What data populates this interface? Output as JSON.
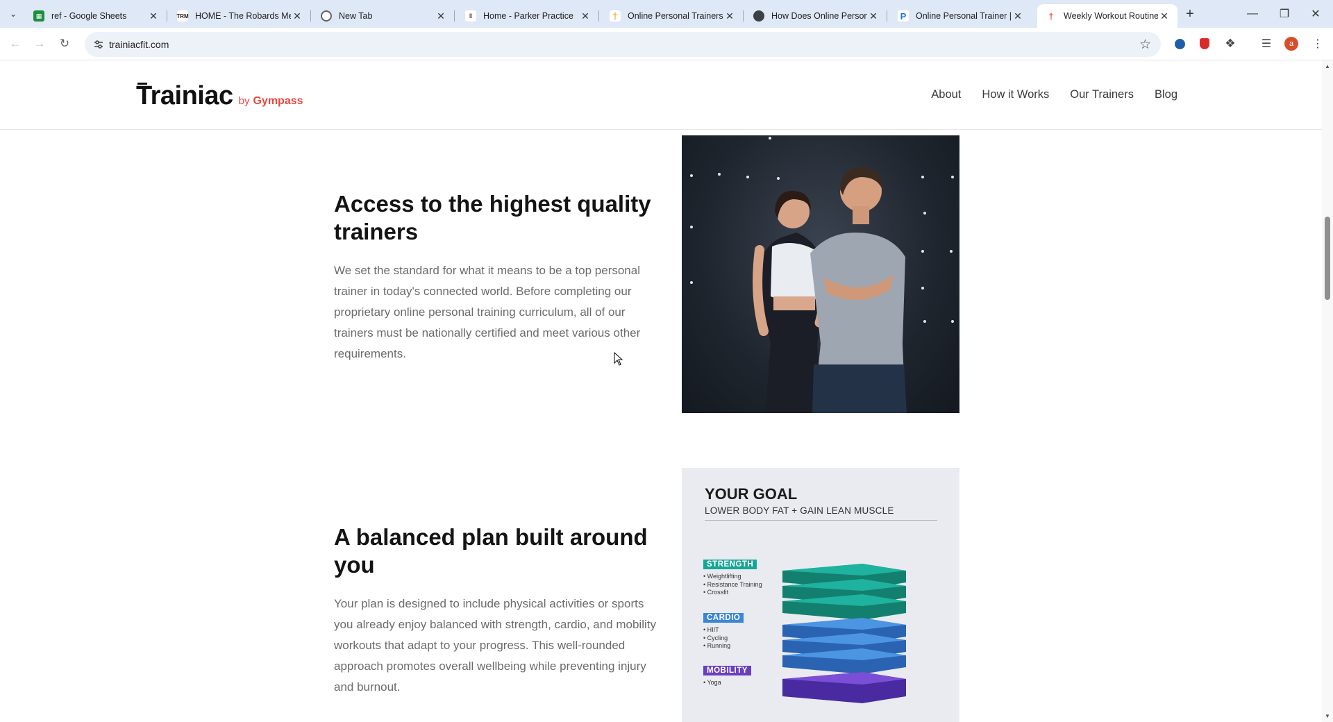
{
  "browser": {
    "tabs": [
      {
        "title": "ref - Google Sheets",
        "favicon": "sheets-icon",
        "color": "#1e8e3e",
        "active": false
      },
      {
        "title": "HOME - The Robards Met",
        "favicon": "trm-icon",
        "color": "#222222",
        "active": false
      },
      {
        "title": "New Tab",
        "favicon": "chrome-icon",
        "color": "#5f6368",
        "active": false
      },
      {
        "title": "Home - Parker Practice",
        "favicon": "parker-icon",
        "color": "#444444",
        "active": false
      },
      {
        "title": "Online Personal Trainers -",
        "favicon": "trainer-icon",
        "color": "#f2b233",
        "active": false
      },
      {
        "title": "How Does Online Persona",
        "favicon": "globe-icon",
        "color": "#3c4043",
        "active": false
      },
      {
        "title": "Online Personal Trainer | C",
        "favicon": "p-icon",
        "color": "#1a73e8",
        "active": false
      },
      {
        "title": "Weekly Workout Routine",
        "favicon": "trainiac-icon",
        "color": "#e8473d",
        "active": true
      }
    ],
    "url": "trainiacfit.com",
    "profile_initial": "a"
  },
  "site": {
    "brand": "Trainiac",
    "by": "by",
    "partner": "Gympass",
    "nav": [
      "About",
      "How it Works",
      "Our Trainers",
      "Blog"
    ]
  },
  "section1": {
    "heading": "Access to the highest quality trainers",
    "body": "We set the standard for what it means to be a top personal trainer in today's connected world. Before completing our proprietary online personal training curriculum, all of our trainers must be nationally certified and meet various other requirements."
  },
  "section2": {
    "heading": "A balanced plan built around you",
    "body": "Your plan is designed to include physical activities or sports you already enjoy balanced with strength, cardio, and mobility workouts that adapt to your progress. This well-rounded approach promotes overall wellbeing while preventing injury and burnout."
  },
  "infographic": {
    "title": "YOUR GOAL",
    "subtitle": "LOWER BODY FAT + GAIN LEAN MUSCLE",
    "categories": [
      {
        "name": "STRENGTH",
        "color": "#17a597",
        "items": [
          "Weightlifting",
          "Resistance Training",
          "Crossfit"
        ]
      },
      {
        "name": "CARDIO",
        "color": "#3d86d6",
        "items": [
          "HIIT",
          "Cycling",
          "Running"
        ]
      },
      {
        "name": "MOBILITY",
        "color": "#6a3fbf",
        "items": [
          "Yoga"
        ]
      }
    ]
  }
}
